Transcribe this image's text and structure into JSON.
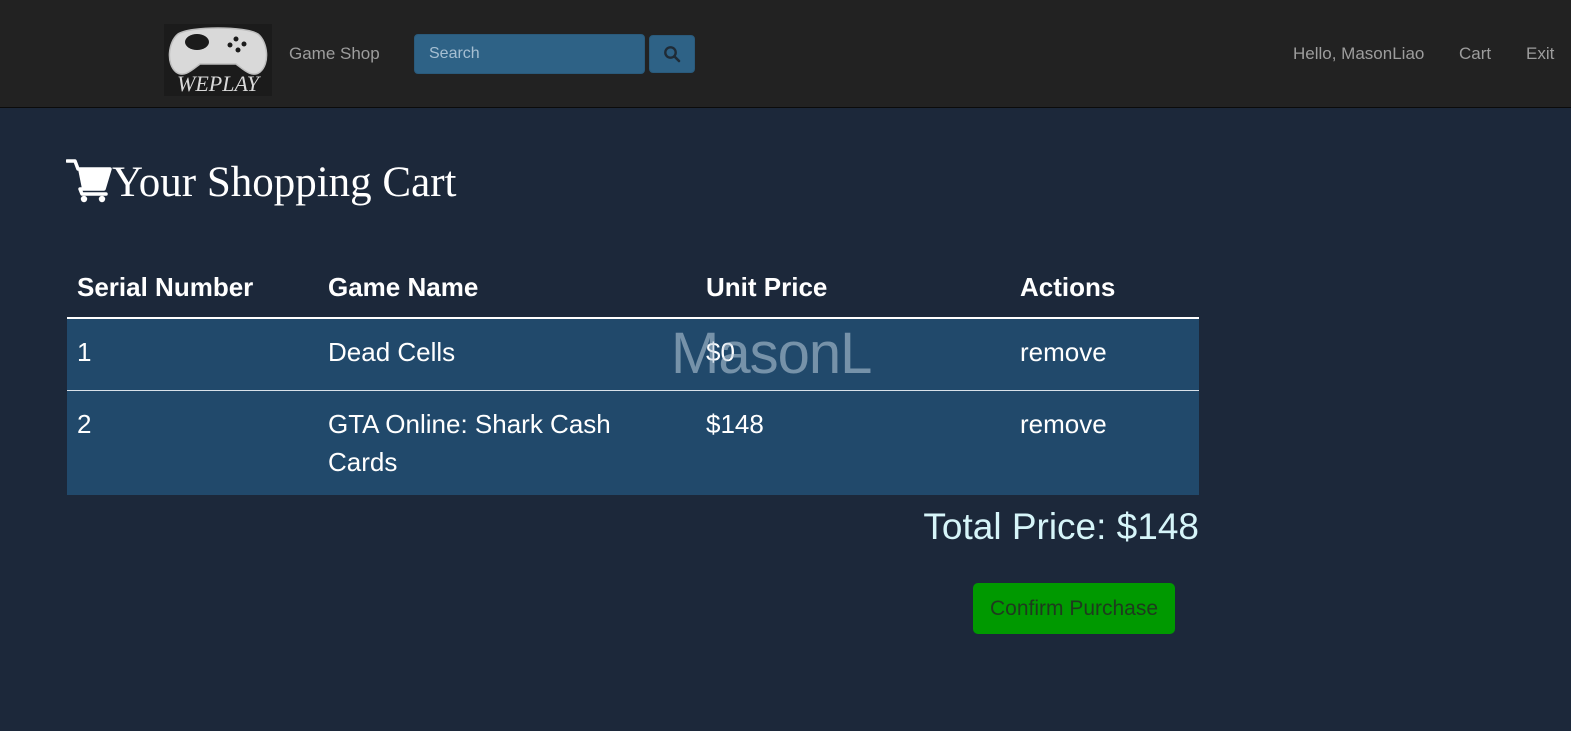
{
  "navbar": {
    "logo_text": "WEPLAY",
    "brand": "Game Shop",
    "search_placeholder": "Search",
    "greeting": "Hello, MasonLiao",
    "cart_link": "Cart",
    "exit_link": "Exit"
  },
  "page": {
    "title": "Your Shopping Cart",
    "watermark": "MasonL"
  },
  "table": {
    "headers": [
      "Serial Number",
      "Game Name",
      "Unit Price",
      "Actions"
    ],
    "rows": [
      {
        "serial": "1",
        "name": "Dead Cells",
        "price": "$0",
        "action": "remove"
      },
      {
        "serial": "2",
        "name": "GTA Online: Shark Cash Cards",
        "price": "$148",
        "action": "remove"
      }
    ]
  },
  "summary": {
    "total": "Total Price: $148",
    "confirm_label": "Confirm Purchase"
  },
  "colors": {
    "background": "#1c283a",
    "navbar": "#222222",
    "row": "#21496b",
    "search": "#2e6286",
    "confirm": "#009900",
    "total_text": "#d6f5f9"
  }
}
